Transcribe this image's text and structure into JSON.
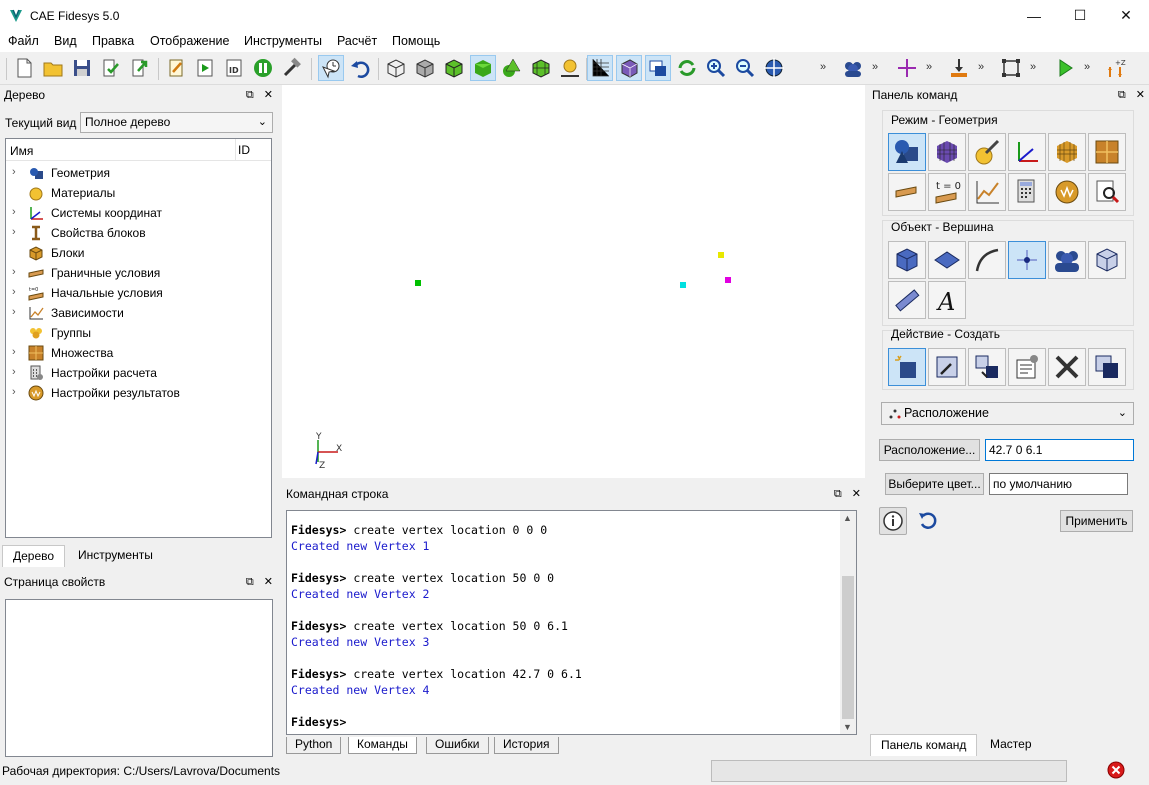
{
  "window": {
    "title": "CAE Fidesys 5.0",
    "minimize": "—",
    "maximize": "☐",
    "close": "✕"
  },
  "menu": [
    "Файл",
    "Вид",
    "Правка",
    "Отображение",
    "Инструменты",
    "Расчёт",
    "Помощь"
  ],
  "toolbar": {
    "overflow": "»"
  },
  "tree_panel": {
    "title": "Дерево",
    "float_glyph": "⧉",
    "close_glyph": "✕",
    "view_label": "Текущий вид",
    "view_value": "Полное дерево",
    "col_name": "Имя",
    "col_id": "ID",
    "items": [
      {
        "label": "Геометрия",
        "icon": "geometry-icon",
        "expandable": true
      },
      {
        "label": "Материалы",
        "icon": "materials-icon",
        "expandable": false
      },
      {
        "label": "Системы координат",
        "icon": "coordinate-systems-icon",
        "expandable": true
      },
      {
        "label": "Свойства блоков",
        "icon": "block-properties-icon",
        "expandable": true
      },
      {
        "label": "Блоки",
        "icon": "blocks-icon",
        "expandable": false
      },
      {
        "label": "Граничные условия",
        "icon": "boundary-conditions-icon",
        "expandable": true
      },
      {
        "label": "Начальные условия",
        "icon": "initial-conditions-icon",
        "expandable": true
      },
      {
        "label": "Зависимости",
        "icon": "dependencies-icon",
        "expandable": true
      },
      {
        "label": "Группы",
        "icon": "groups-icon",
        "expandable": false
      },
      {
        "label": "Множества",
        "icon": "sets-icon",
        "expandable": true
      },
      {
        "label": "Настройки расчета",
        "icon": "calc-settings-icon",
        "expandable": true
      },
      {
        "label": "Настройки результатов",
        "icon": "result-settings-icon",
        "expandable": true
      }
    ],
    "tabs": [
      "Дерево",
      "Инструменты"
    ]
  },
  "props_panel": {
    "title": "Страница свойств"
  },
  "viewport": {
    "axis_y": "Y",
    "axis_x": "X",
    "axis_z": "Z",
    "vertex_colors": [
      "#00c000",
      "#e8e800",
      "#00e0e0",
      "#e000e0"
    ]
  },
  "command_line": {
    "title": "Командная строка",
    "entries": [
      {
        "prompt": "Fidesys>",
        "cmd": " create vertex location 0 0 0",
        "resp": "Created new Vertex 1"
      },
      {
        "prompt": "Fidesys>",
        "cmd": " create vertex location 50 0 0",
        "resp": "Created new Vertex 2"
      },
      {
        "prompt": "Fidesys>",
        "cmd": " create vertex location 50 0 6.1",
        "resp": "Created new Vertex 3"
      },
      {
        "prompt": "Fidesys>",
        "cmd": " create vertex location 42.7 0 6.1",
        "resp": "Created new Vertex 4"
      }
    ],
    "last_prompt": "Fidesys>",
    "tabs": [
      "Python",
      "Команды",
      "Ошибки",
      "История"
    ]
  },
  "command_panel": {
    "title": "Панель команд",
    "mode_group": "Режим - Геометрия",
    "object_group": "Объект - Вершина",
    "action_group": "Действие - Создать",
    "method_value": "Расположение",
    "location_button": "Расположение...",
    "location_value": "42.7 0 6.1",
    "color_button": "Выберите цвет...",
    "color_value": "по умолчанию",
    "apply_button": "Применить",
    "tabs": [
      "Панель команд",
      "Мастер"
    ]
  },
  "status": {
    "working_dir": "Рабочая директория: C:/Users/Lavrova/Documents"
  },
  "colors": {
    "accent": "#0078d7",
    "response": "#1a1acc"
  }
}
